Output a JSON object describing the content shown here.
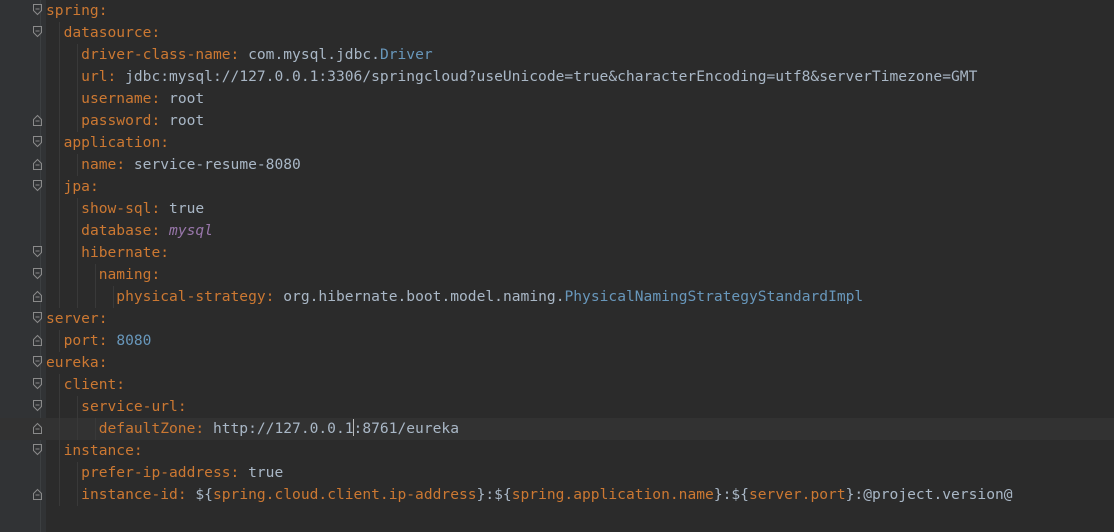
{
  "editor": {
    "lines": [
      {
        "indent": 0,
        "key": "spring",
        "sep": ":",
        "fold": "open"
      },
      {
        "indent": 1,
        "key": "datasource",
        "sep": ":",
        "fold": "open"
      },
      {
        "indent": 2,
        "key": "driver-class-name",
        "sep": ": ",
        "value": "com.mysql.jdbc.Driver",
        "vtype": "class"
      },
      {
        "indent": 2,
        "key": "url",
        "sep": ": ",
        "value": "jdbc:mysql://127.0.0.1:3306/springcloud?useUnicode=true&characterEncoding=utf8&serverTimezone=GMT",
        "vtype": "plain"
      },
      {
        "indent": 2,
        "key": "username",
        "sep": ": ",
        "value": "root",
        "vtype": "plain"
      },
      {
        "indent": 2,
        "key": "password",
        "sep": ": ",
        "value": "root",
        "vtype": "plain",
        "fold": "close"
      },
      {
        "indent": 1,
        "key": "application",
        "sep": ":",
        "fold": "open"
      },
      {
        "indent": 2,
        "key": "name",
        "sep": ": ",
        "value": "service-resume-8080",
        "vtype": "plain",
        "fold": "close"
      },
      {
        "indent": 1,
        "key": "jpa",
        "sep": ":",
        "fold": "open"
      },
      {
        "indent": 2,
        "key": "show-sql",
        "sep": ": ",
        "value": "true",
        "vtype": "plain"
      },
      {
        "indent": 2,
        "key": "database",
        "sep": ": ",
        "value": "mysql",
        "vtype": "italic"
      },
      {
        "indent": 2,
        "key": "hibernate",
        "sep": ":",
        "fold": "open"
      },
      {
        "indent": 3,
        "key": "naming",
        "sep": ":",
        "fold": "open"
      },
      {
        "indent": 4,
        "key": "physical-strategy",
        "sep": ": ",
        "value": "org.hibernate.boot.model.naming.PhysicalNamingStrategyStandardImpl",
        "vtype": "class",
        "fold": "close"
      },
      {
        "indent": 0,
        "key": "server",
        "sep": ":",
        "fold": "open"
      },
      {
        "indent": 1,
        "key": "port",
        "sep": ": ",
        "value": "8080",
        "vtype": "number",
        "fold": "close"
      },
      {
        "indent": 0,
        "key": "eureka",
        "sep": ":",
        "fold": "open"
      },
      {
        "indent": 1,
        "key": "client",
        "sep": ":",
        "fold": "open"
      },
      {
        "indent": 2,
        "key": "service-url",
        "sep": ":",
        "fold": "open"
      },
      {
        "indent": 3,
        "key": "defaultZone",
        "sep": ": ",
        "value": "http://127.0.0.1",
        "value2": ":8761/eureka",
        "vtype": "plain",
        "current": true,
        "caret": true,
        "fold": "close"
      },
      {
        "indent": 1,
        "key": "instance",
        "sep": ":",
        "fold": "open"
      },
      {
        "indent": 2,
        "key": "prefer-ip-address",
        "sep": ": ",
        "value": "true",
        "vtype": "plain"
      },
      {
        "indent": 2,
        "key": "instance-id",
        "sep": ": ",
        "vtype": "template",
        "fold": "close",
        "parts": [
          {
            "t": "${",
            "c": "v"
          },
          {
            "t": "spring.cloud.client.ip-address",
            "c": "k"
          },
          {
            "t": "}:${",
            "c": "v"
          },
          {
            "t": "spring.application.name",
            "c": "k"
          },
          {
            "t": "}:${",
            "c": "v"
          },
          {
            "t": "server.port",
            "c": "k"
          },
          {
            "t": "}:@project.version@",
            "c": "v"
          }
        ]
      }
    ]
  },
  "colors": {
    "background": "#2b2b2b",
    "key": "#cc7832",
    "value": "#a9b7c6",
    "number": "#6897bb",
    "italic": "#9876aa",
    "current_line": "#323232"
  },
  "icons": {
    "fold_open": "fold-open-icon",
    "fold_close": "fold-close-icon"
  }
}
